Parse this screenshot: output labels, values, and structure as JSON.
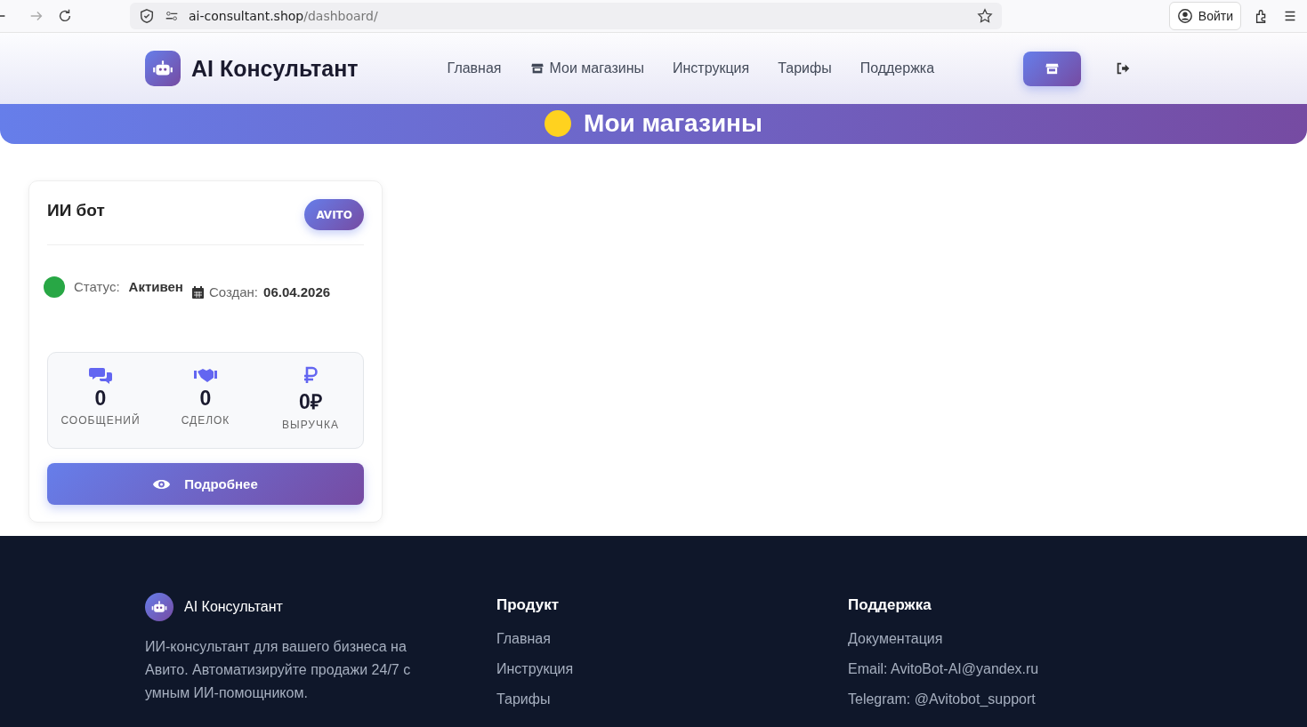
{
  "browser": {
    "url_host": "ai-consultant.shop",
    "url_path": "/dashboard/",
    "login_label": "Войти"
  },
  "header": {
    "brand": "AI Консультант",
    "nav": [
      {
        "label": "Главная",
        "kind": "text"
      },
      {
        "label": "Мои магазины",
        "kind": "icon"
      },
      {
        "label": "Инструкция",
        "kind": "text"
      },
      {
        "label": "Тарифы",
        "kind": "text"
      },
      {
        "label": "Поддержка",
        "kind": "text"
      }
    ]
  },
  "hero": {
    "title": "Мои магазины"
  },
  "stores": [
    {
      "name": "ИИ бот",
      "platform": "AVITO",
      "status_label": "Статус:",
      "status": "Активен",
      "active": true,
      "created_label": "Создан:",
      "created": "06.04.2026",
      "stats": [
        {
          "kind": "messages",
          "value": "0",
          "label": "СООБЩЕНИЙ"
        },
        {
          "kind": "deals",
          "value": "0",
          "label": "СДЕЛОК"
        },
        {
          "kind": "revenue",
          "value": "0₽",
          "label": "ВЫРУЧКА"
        }
      ],
      "button": "Подробнее"
    }
  ],
  "footer": {
    "brand": "AI Консультант",
    "description": "ИИ-консультант для вашего бизнеса на Авито. Автоматизируйте продажи 24/7 с умным ИИ-помощником.",
    "columns": [
      {
        "title": "Продукт",
        "links": [
          "Главная",
          "Инструкция",
          "Тарифы"
        ]
      },
      {
        "title": "Поддержка",
        "links": [
          "Документация",
          "Email: AvitoBot-AI@yandex.ru",
          "Telegram: @Avitobot_support"
        ]
      }
    ]
  }
}
